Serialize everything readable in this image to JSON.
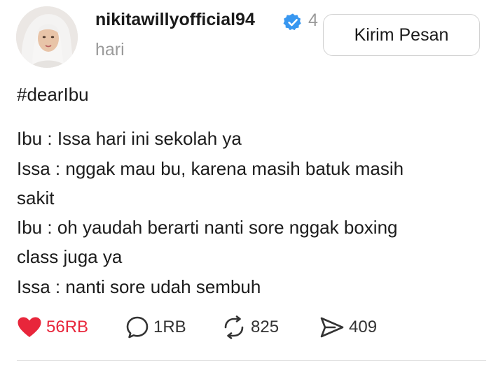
{
  "post": {
    "username": "nikitawillyofficial94",
    "time_num": "4",
    "time_unit": "hari",
    "send_button_label": "Kirim Pesan",
    "lines": [
      "#dearIbu",
      "Ibu : Issa hari ini sekolah ya",
      "Issa : nggak mau bu, karena masih batuk masih",
      "sakit",
      "Ibu : oh yaudah berarti nanti sore nggak boxing",
      "class juga ya",
      "Issa : nanti sore udah sembuh"
    ]
  },
  "actions": {
    "likes": "56RB",
    "comments": "1RB",
    "reposts": "825",
    "shares": "409"
  },
  "colors": {
    "like": "#e8263b",
    "verified": "#3897f0",
    "muted": "#9a9a9a"
  },
  "icons": {
    "like": "heart-icon",
    "comment": "comment-bubble-icon",
    "repost": "repost-icon",
    "share": "send-icon",
    "verified": "verified-badge-icon"
  }
}
